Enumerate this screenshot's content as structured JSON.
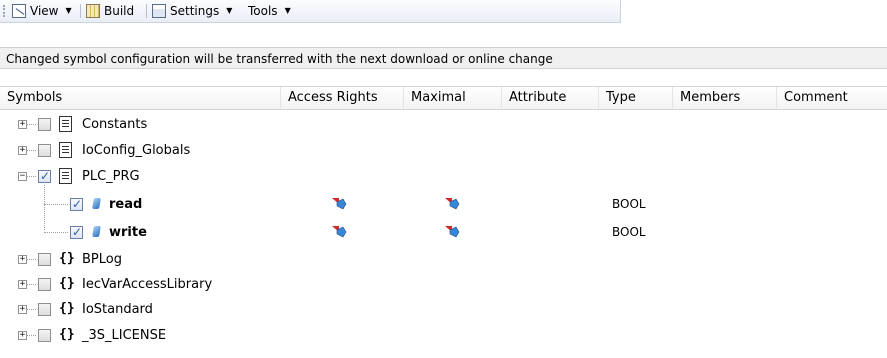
{
  "toolbar": {
    "view": "View",
    "build": "Build",
    "settings": "Settings",
    "tools": "Tools"
  },
  "info": "Changed symbol configuration will be transferred with the next download or online change",
  "columns": [
    "Symbols",
    "Access Rights",
    "Maximal",
    "Attribute",
    "Type",
    "Members",
    "Comment"
  ],
  "tree": [
    {
      "label": "Constants",
      "icon": "document-icon",
      "checked": false,
      "expanded": false
    },
    {
      "label": "IoConfig_Globals",
      "icon": "document-icon",
      "checked": false,
      "expanded": false
    },
    {
      "label": "PLC_PRG",
      "icon": "document-icon",
      "checked": true,
      "expanded": true,
      "children": [
        {
          "label": "read",
          "checked": true,
          "type": "BOOL",
          "access": "read-write-icon",
          "maximal": "read-write-icon"
        },
        {
          "label": "write",
          "checked": true,
          "type": "BOOL",
          "access": "read-write-icon",
          "maximal": "read-write-icon"
        }
      ]
    },
    {
      "label": "BPLog",
      "icon": "braces-icon",
      "checked": false,
      "expanded": false
    },
    {
      "label": "IecVarAccessLibrary",
      "icon": "braces-icon",
      "checked": false,
      "expanded": false
    },
    {
      "label": "IoStandard",
      "icon": "braces-icon",
      "checked": false,
      "expanded": false
    },
    {
      "label": "_3S_LICENSE",
      "icon": "braces-icon",
      "checked": false,
      "expanded": false
    }
  ]
}
